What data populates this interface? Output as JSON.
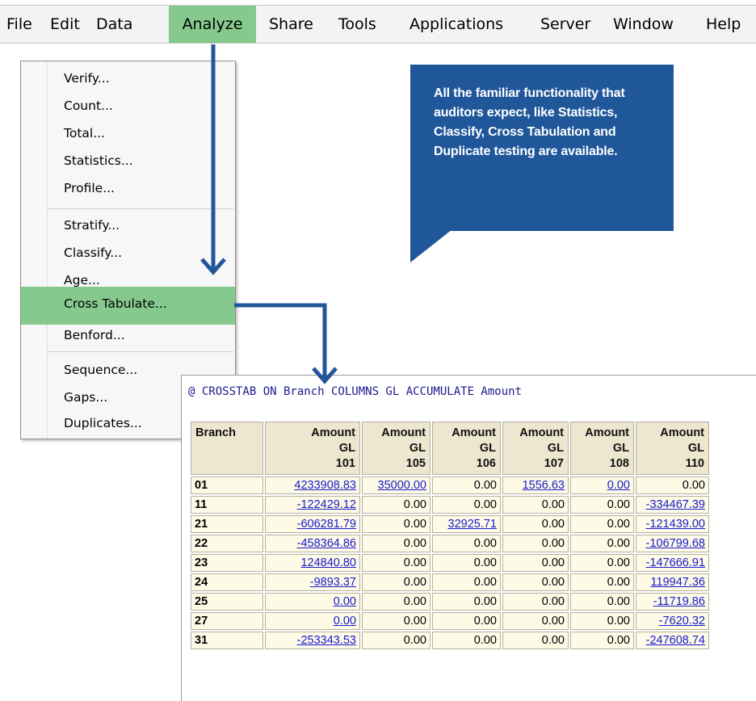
{
  "menubar": {
    "items": [
      "File",
      "Edit",
      "Data",
      "Analyze",
      "Share",
      "Tools",
      "Applications",
      "Server",
      "Window",
      "Help"
    ],
    "active": "Analyze"
  },
  "dropdown": {
    "groups": [
      [
        "Verify...",
        "Count...",
        "Total...",
        "Statistics...",
        "Profile..."
      ],
      [
        "Stratify...",
        "Classify...",
        "Age...",
        "Cross Tabulate...",
        "Benford..."
      ],
      [
        "Sequence...",
        "Gaps...",
        "Duplicates..."
      ]
    ],
    "highlighted": "Cross Tabulate..."
  },
  "callout": {
    "text": "All the familiar functionality that auditors expect, like Statistics, Classify, Cross Tabulation and Duplicate testing are available.",
    "color": "#1f579a"
  },
  "result": {
    "command": "@ CROSSTAB ON Branch COLUMNS GL ACCUMULATE Amount",
    "header": {
      "branch": "Branch",
      "line1": "Amount",
      "line2": "GL",
      "gl_codes": [
        "101",
        "105",
        "106",
        "107",
        "108",
        "110"
      ]
    },
    "rows": [
      {
        "branch": "01",
        "values": [
          "4233908.83",
          "35000.00",
          "0.00",
          "1556.63",
          "0.00",
          "0.00"
        ],
        "links": [
          true,
          true,
          false,
          true,
          true,
          false
        ]
      },
      {
        "branch": "11",
        "values": [
          "-122429.12",
          "0.00",
          "0.00",
          "0.00",
          "0.00",
          "-334467.39"
        ],
        "links": [
          true,
          false,
          false,
          false,
          false,
          true
        ]
      },
      {
        "branch": "21",
        "values": [
          "-606281.79",
          "0.00",
          "32925.71",
          "0.00",
          "0.00",
          "-121439.00"
        ],
        "links": [
          true,
          false,
          true,
          false,
          false,
          true
        ]
      },
      {
        "branch": "22",
        "values": [
          "-458364.86",
          "0.00",
          "0.00",
          "0.00",
          "0.00",
          "-106799.68"
        ],
        "links": [
          true,
          false,
          false,
          false,
          false,
          true
        ]
      },
      {
        "branch": "23",
        "values": [
          "124840.80",
          "0.00",
          "0.00",
          "0.00",
          "0.00",
          "-147666.91"
        ],
        "links": [
          true,
          false,
          false,
          false,
          false,
          true
        ]
      },
      {
        "branch": "24",
        "values": [
          "-9893.37",
          "0.00",
          "0.00",
          "0.00",
          "0.00",
          "119947.36"
        ],
        "links": [
          true,
          false,
          false,
          false,
          false,
          true
        ]
      },
      {
        "branch": "25",
        "values": [
          "0.00",
          "0.00",
          "0.00",
          "0.00",
          "0.00",
          "-11719.86"
        ],
        "links": [
          true,
          false,
          false,
          false,
          false,
          true
        ]
      },
      {
        "branch": "27",
        "values": [
          "0.00",
          "0.00",
          "0.00",
          "0.00",
          "0.00",
          "-7620.32"
        ],
        "links": [
          true,
          false,
          false,
          false,
          false,
          true
        ]
      },
      {
        "branch": "31",
        "values": [
          "-253343.53",
          "0.00",
          "0.00",
          "0.00",
          "0.00",
          "-247608.74"
        ],
        "links": [
          true,
          false,
          false,
          false,
          false,
          true
        ]
      }
    ],
    "link_color": "#1a1ad0"
  },
  "annotation_arrow_color": "#1f579a"
}
